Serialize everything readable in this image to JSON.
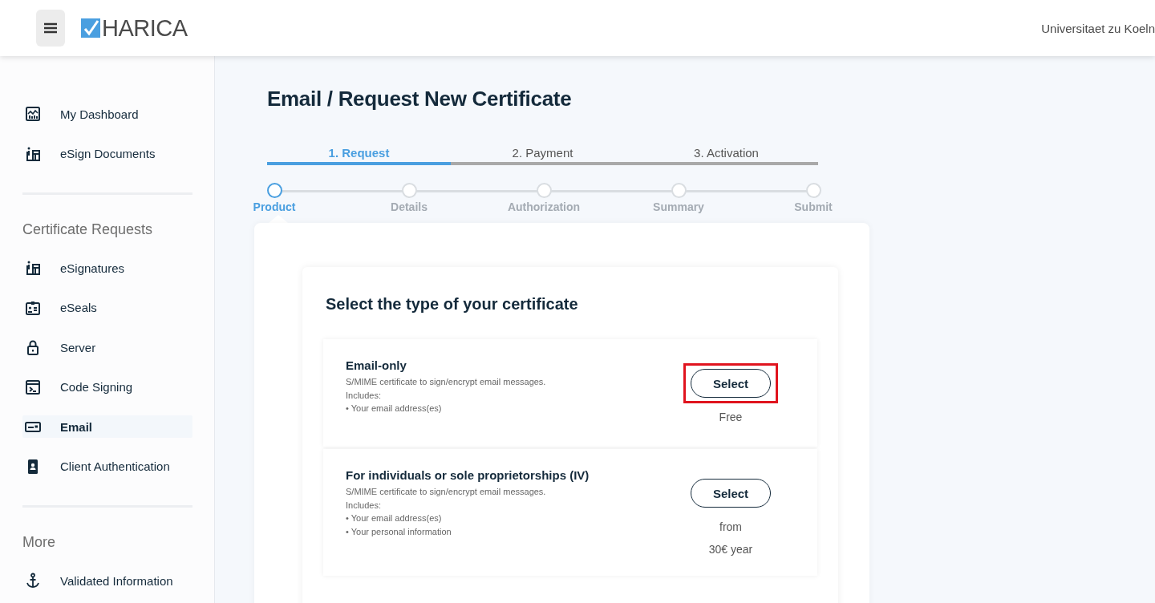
{
  "header": {
    "logo": "HARICA",
    "user": "Universitaet zu Koeln"
  },
  "sidebar": {
    "groups": [
      {
        "items": [
          {
            "label": "My Dashboard",
            "kind": "dashboard",
            "selected": false
          },
          {
            "label": "eSign Documents",
            "kind": "esign",
            "selected": false
          }
        ]
      },
      {
        "title": "Certificate Requests",
        "items": [
          {
            "label": "eSignatures",
            "kind": "esign",
            "selected": false
          },
          {
            "label": "eSeals",
            "kind": "seal",
            "selected": false
          },
          {
            "label": "Server",
            "kind": "lock",
            "selected": false
          },
          {
            "label": "Code Signing",
            "kind": "code",
            "selected": false
          },
          {
            "label": "Email",
            "kind": "email",
            "selected": true
          },
          {
            "label": "Client Authentication",
            "kind": "badge",
            "selected": false
          }
        ]
      },
      {
        "title": "More",
        "items": [
          {
            "label": "Validated Information",
            "kind": "anchor",
            "selected": false
          }
        ]
      }
    ]
  },
  "page_title": "Email / Request New Certificate",
  "phases": [
    {
      "label": "1. Request",
      "selected": true
    },
    {
      "label": "2. Payment",
      "selected": false
    },
    {
      "label": "3. Activation",
      "selected": false
    }
  ],
  "steps": [
    {
      "label": "Product",
      "selected": true
    },
    {
      "label": "Details",
      "selected": false
    },
    {
      "label": "Authorization",
      "selected": false
    },
    {
      "label": "Summary",
      "selected": false
    },
    {
      "label": "Submit",
      "selected": false
    }
  ],
  "card": {
    "title": "Select the type of your certificate",
    "options": [
      {
        "title": "Email-only",
        "description": [
          "S/MIME certificate to sign/encrypt email messages.",
          "Includes:",
          "• Your email address(es)"
        ],
        "button": "Select",
        "price": [
          "Free"
        ],
        "highlighted": true
      },
      {
        "title": "For individuals or sole proprietorships (IV)",
        "description": [
          "S/MIME certificate to sign/encrypt email messages.",
          "Includes:",
          "• Your email address(es)",
          "• Your personal information"
        ],
        "button": "Select",
        "price": [
          "from",
          "30€ year"
        ],
        "highlighted": false
      }
    ]
  }
}
